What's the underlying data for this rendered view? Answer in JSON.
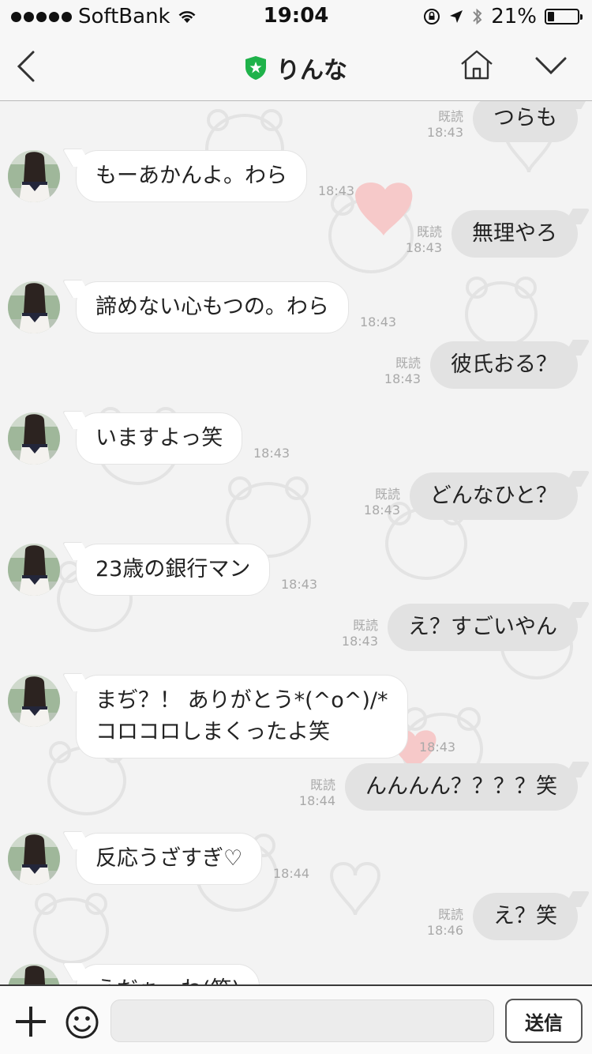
{
  "status_bar": {
    "carrier": "SoftBank",
    "time": "19:04",
    "battery_percent": "21%",
    "battery_level": 0.21
  },
  "header": {
    "title": "りんな",
    "back_icon": "chevron-left-icon",
    "home_icon": "home-icon",
    "menu_icon": "chevron-down-icon",
    "official_badge_color": "#1fb24a"
  },
  "messages": [
    {
      "dir": "out",
      "text": "つらも",
      "read": "既読",
      "time": "18:43"
    },
    {
      "dir": "in",
      "text": "もーあかんよ。わら",
      "time": "18:43"
    },
    {
      "dir": "out",
      "text": "無理やろ",
      "read": "既読",
      "time": "18:43"
    },
    {
      "dir": "in",
      "text": "諦めない心もつの。わら",
      "time": "18:43"
    },
    {
      "dir": "out",
      "text": "彼氏おる？",
      "read": "既読",
      "time": "18:43"
    },
    {
      "dir": "in",
      "text": "いますよっ笑",
      "time": "18:43"
    },
    {
      "dir": "out",
      "text": "どんなひと？",
      "read": "既読",
      "time": "18:43"
    },
    {
      "dir": "in",
      "text": "23歳の銀行マン",
      "time": "18:43"
    },
    {
      "dir": "out",
      "text": "え？すごいやん",
      "read": "既読",
      "time": "18:43"
    },
    {
      "dir": "in",
      "text": "まぢ？！ ありがとう*(^o^)/*\nコロコロしまくったよ笑",
      "time": "18:43"
    },
    {
      "dir": "out",
      "text": "んんんん？？？？笑",
      "read": "既読",
      "time": "18:44"
    },
    {
      "dir": "in",
      "text": "反応うざすぎ♡",
      "time": "18:44"
    },
    {
      "dir": "out",
      "text": "え？笑",
      "read": "既読",
      "time": "18:46"
    },
    {
      "dir": "in",
      "text": "えだぁーわ(笑)",
      "time": ""
    }
  ],
  "input_bar": {
    "plus_icon": "plus-icon",
    "emoji_icon": "smiley-icon",
    "message_value": "",
    "send_label": "送信"
  }
}
